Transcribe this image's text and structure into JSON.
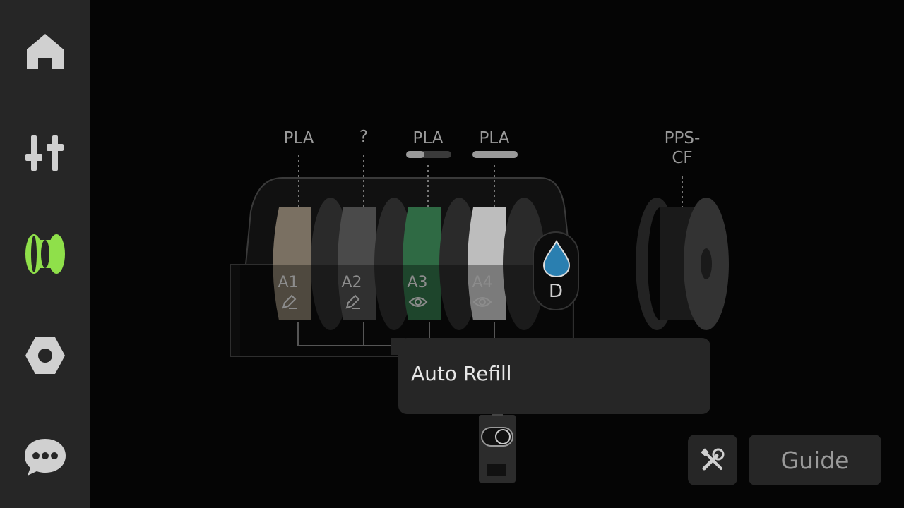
{
  "sidebar": {
    "items": [
      {
        "icon": "home-icon"
      },
      {
        "icon": "sliders-icon"
      },
      {
        "icon": "filament-icon",
        "active": true,
        "color": "#8fe04a"
      },
      {
        "icon": "nut-icon"
      },
      {
        "icon": "chat-icon"
      }
    ]
  },
  "ams": {
    "slots": [
      {
        "id": "A1",
        "material": "PLA",
        "color": "#7a7062",
        "mode_icon": "pencil-icon"
      },
      {
        "id": "A2",
        "material": "?",
        "color": "#4a4a4a",
        "mode_icon": "pencil-icon"
      },
      {
        "id": "A3",
        "material": "PLA",
        "color": "#2f6a44",
        "mode_icon": "eye-icon",
        "remaining": 0.4
      },
      {
        "id": "A4",
        "material": "PLA",
        "color": "#bdbdbd",
        "mode_icon": "eye-icon",
        "remaining": 1.0
      }
    ],
    "dryer": {
      "label": "D",
      "color": "#2a7fb0"
    }
  },
  "external_spool": {
    "material_line1": "PPS-",
    "material_line2": "CF"
  },
  "popup": {
    "title": "Auto Refill"
  },
  "actions": {
    "guide_label": "Guide",
    "tool_icon": "tools-icon"
  }
}
